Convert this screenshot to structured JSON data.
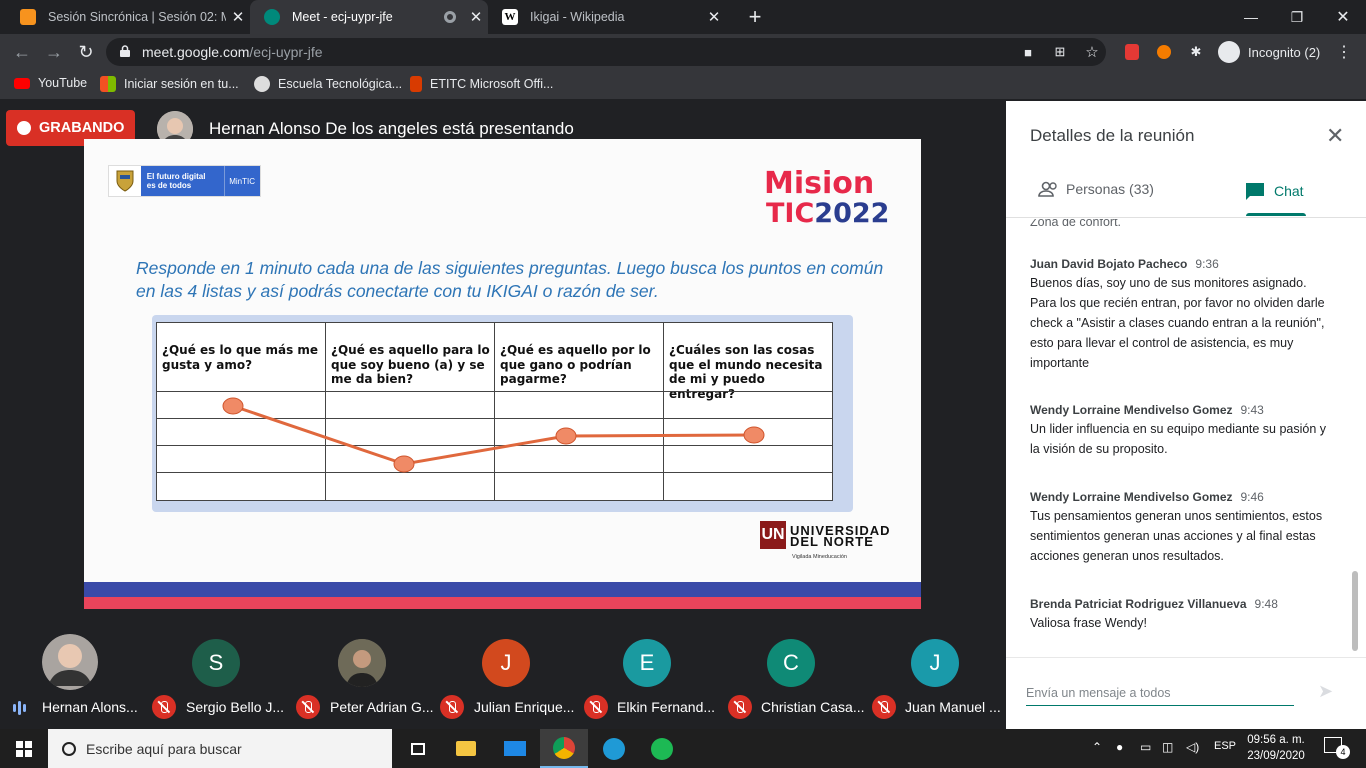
{
  "browser": {
    "tabs": [
      {
        "title": "Sesión Sincrónica | Sesión 02: Mi",
        "active": false
      },
      {
        "title": "Meet - ecj-uypr-jfe",
        "active": true
      },
      {
        "title": "Ikigai - Wikipedia",
        "active": false
      }
    ],
    "url_host": "meet.google.com",
    "url_path": "/ecj-uypr-jfe",
    "incognito_label": "Incognito (2)",
    "bookmarks": [
      "YouTube",
      "Iniciar sesión en tu...",
      "Escuela Tecnológica...",
      "ETITC Microsoft Offi..."
    ]
  },
  "meet": {
    "recording_label": "GRABANDO",
    "presenter_text": "Hernan Alonso De los angeles está presentando"
  },
  "slide": {
    "gov_line1": "El futuro digital",
    "gov_line2": "es de todos",
    "gov_mintic": "MinTIC",
    "mision_line1": "Mision",
    "mision_line2a": "TIC",
    "mision_line2b": "2022",
    "question": "Responde en 1 minuto cada una de las siguientes preguntas. Luego busca los puntos en común en las 4 listas y así podrás conectarte con tu IKIGAI o razón de ser.",
    "columns": [
      "¿Qué es lo que más me gusta y amo?",
      "¿Qué es aquello para lo que soy bueno (a) y se me da bien?",
      "¿Qué es aquello por lo que gano o podrían pagarme?",
      "¿Cuáles son las cosas que el mundo necesita de mi y puedo entregar?"
    ],
    "uni_mark": "UN",
    "uni_name1": "UNIVERSIDAD",
    "uni_name2": "DEL NORTE",
    "uni_sub": "Vigilada Mineducación"
  },
  "participants": [
    {
      "name": "Hernan Alons...",
      "initial": "",
      "color": "#3c4043",
      "muted": false,
      "photo": true
    },
    {
      "name": "Sergio Bello J...",
      "initial": "S",
      "color": "#1e5e4a",
      "muted": true,
      "photo": false
    },
    {
      "name": "Peter Adrian G...",
      "initial": "",
      "color": "#5a5a5a",
      "muted": true,
      "photo": true
    },
    {
      "name": "Julian Enrique...",
      "initial": "J",
      "color": "#d2491e",
      "muted": true,
      "photo": false
    },
    {
      "name": "Elkin Fernand...",
      "initial": "E",
      "color": "#1a9aa0",
      "muted": true,
      "photo": false
    },
    {
      "name": "Christian Casa...",
      "initial": "C",
      "color": "#0f8a76",
      "muted": true,
      "photo": false
    },
    {
      "name": "Juan Manuel ...",
      "initial": "J",
      "color": "#1a9aaa",
      "muted": true,
      "photo": false
    }
  ],
  "panel": {
    "title": "Detalles de la reunión",
    "tab_people": "Personas (33)",
    "tab_chat": "Chat",
    "cut_text": "Zona de confort.",
    "messages": [
      {
        "author": "Juan David Bojato Pacheco",
        "time": "9:36",
        "text": "Buenos días, soy uno de sus monitores asignado. Para los que recién entran, por favor no olviden darle check a \"Asistir a clases cuando entran a la reunión\", esto para llevar el control de asistencia, es muy importante"
      },
      {
        "author": "Wendy Lorraine Mendivelso Gomez",
        "time": "9:43",
        "text": "Un lider influencia en su equipo mediante su pasión  y la visión de su proposito."
      },
      {
        "author": "Wendy Lorraine Mendivelso Gomez",
        "time": "9:46",
        "text": "Tus pensamientos generan unos sentimientos, estos sentimientos generan unas acciones y al final estas acciones generan unos resultados."
      },
      {
        "author": "Brenda Patriciat Rodriguez Villanueva",
        "time": "9:48",
        "text": "Valiosa frase Wendy!"
      }
    ],
    "compose_placeholder": "Envía un mensaje a todos"
  },
  "taskbar": {
    "search_placeholder": "Escribe aquí para buscar",
    "lang": "ESP",
    "time": "09:56 a. m.",
    "date": "23/09/2020",
    "notifications": "4"
  }
}
